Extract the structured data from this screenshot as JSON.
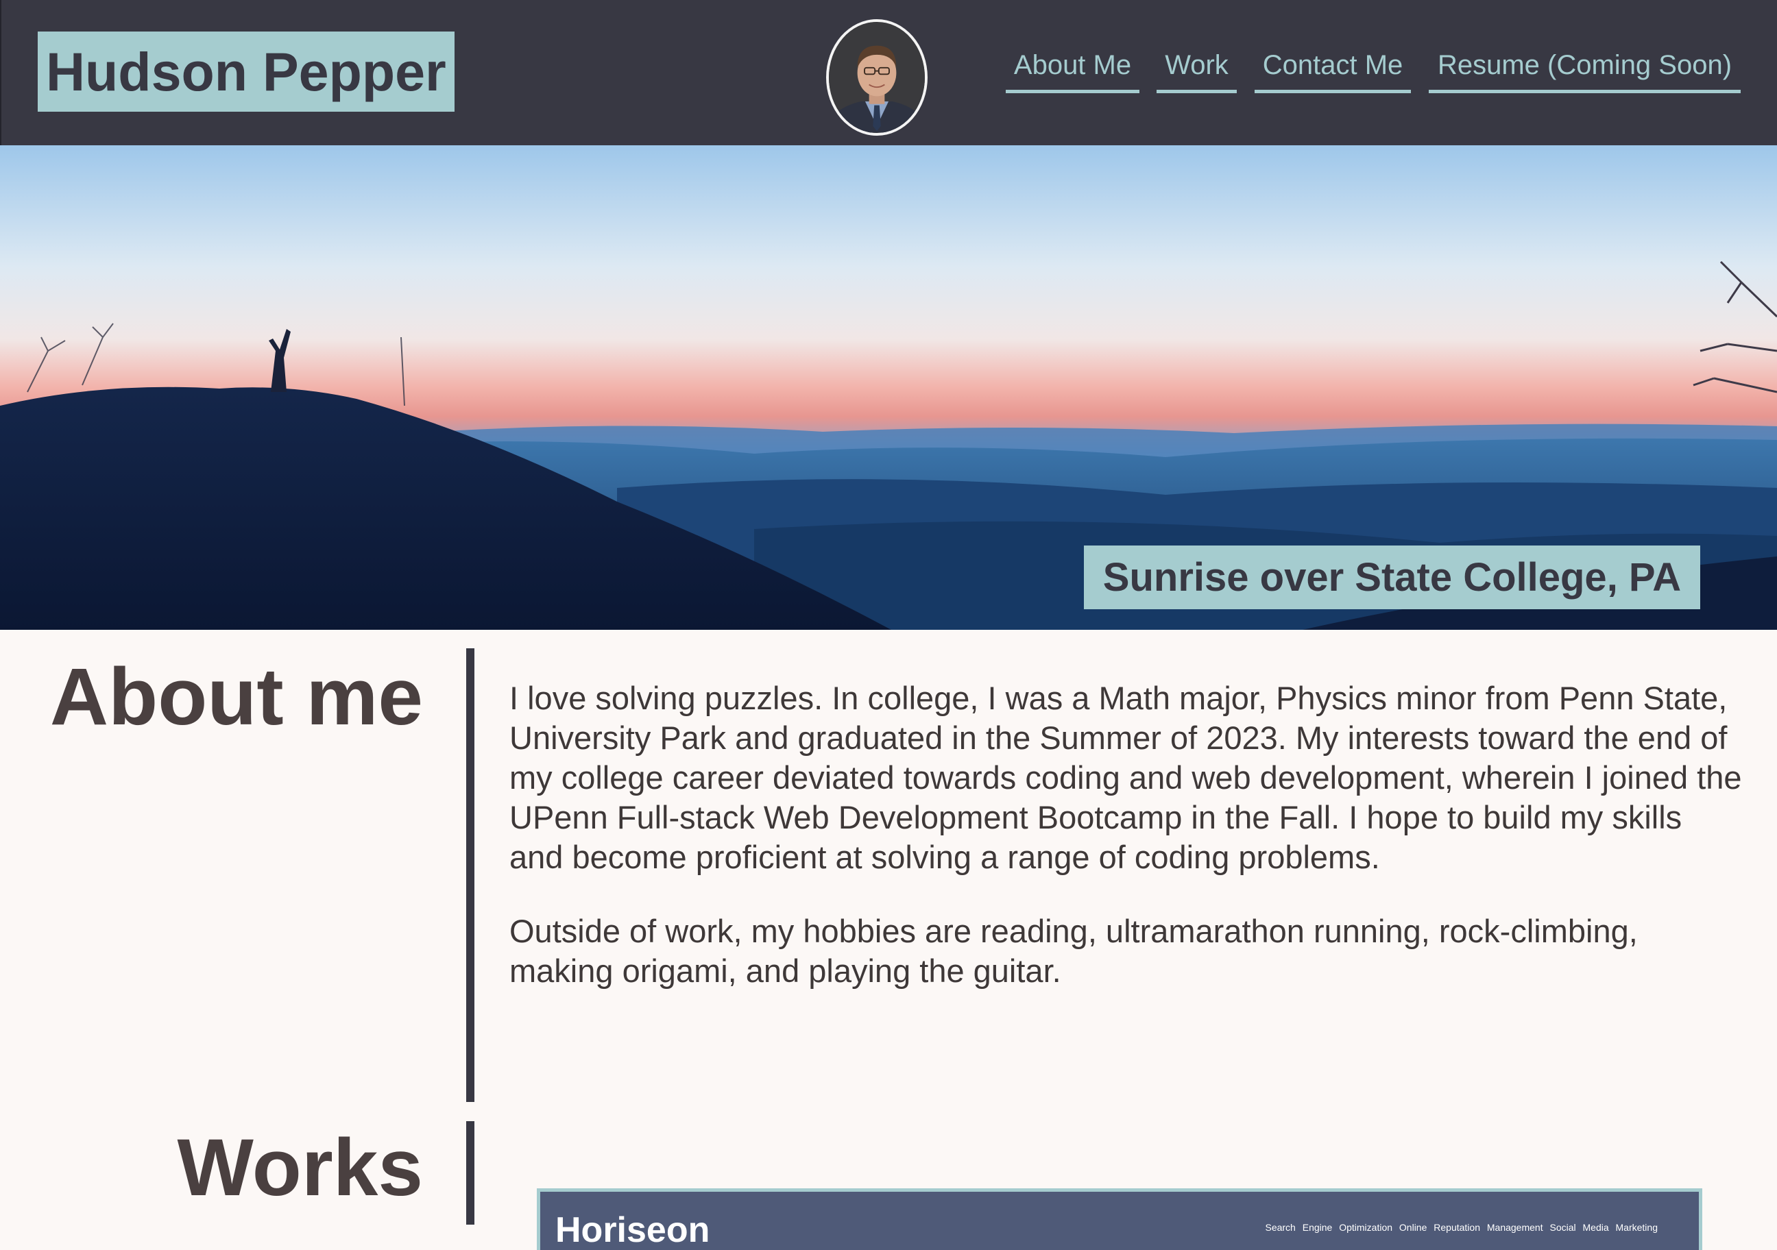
{
  "header": {
    "name": "Hudson Pepper",
    "avatar_alt": "Hudson Pepper portrait",
    "nav": [
      {
        "label": "About Me"
      },
      {
        "label": "Work"
      },
      {
        "label": "Contact Me"
      },
      {
        "label": "Resume (Coming Soon)"
      }
    ]
  },
  "hero": {
    "caption": "Sunrise over State College, PA"
  },
  "about": {
    "title": "About me",
    "paragraphs": [
      "I love solving puzzles. In college, I was a Math major, Physics minor from Penn State, University Park and graduated in the Summer of 2023. My interests toward the end of my college career deviated towards coding and web development, wherein I joined the UPenn Full-stack Web Development Bootcamp in the Fall. I hope to build my skills and become proficient at solving a range of coding problems.",
      "Outside of work, my hobbies are reading, ultramarathon running, rock-climbing, making origami, and playing the guitar."
    ]
  },
  "works": {
    "title": "Works",
    "cards": [
      {
        "title": "Horiseon",
        "tags": "Search Engine Optimization   Online Reputation Management   Social Media Marketing"
      }
    ]
  },
  "colors": {
    "header_bg": "#383843",
    "accent": "#a5cccf",
    "page_bg": "#fcf8f6",
    "heading_text": "#4a4040",
    "card_bg": "#4f5a78"
  }
}
